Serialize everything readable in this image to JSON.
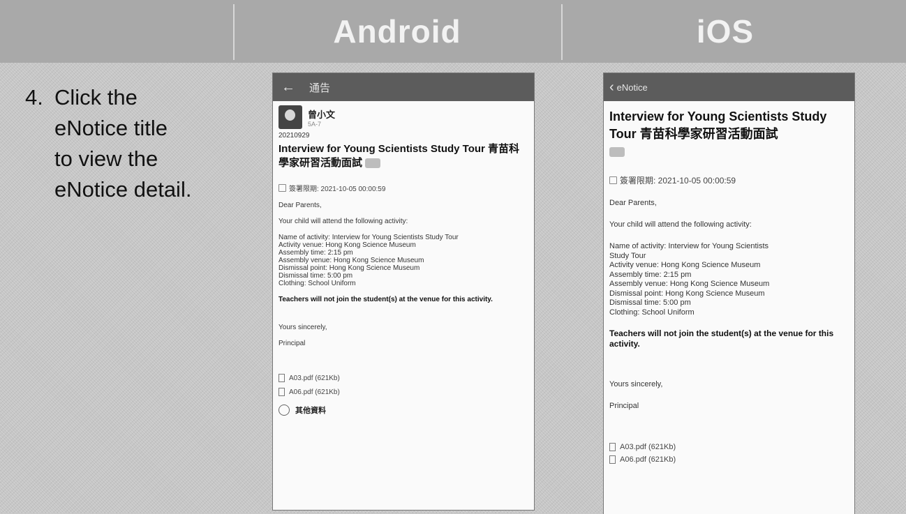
{
  "header": {
    "android_label": "Android",
    "ios_label": "iOS"
  },
  "instruction": {
    "number": "4.",
    "lines": [
      "Click the",
      "eNotice title",
      "to view the",
      "eNotice detail."
    ]
  },
  "android": {
    "appbar_title": "通告",
    "author_name": "曾小文",
    "author_class": "5A-7",
    "date": "20210929",
    "title": "Interview for Young Scientists Study Tour 青苗科學家研習活動面試",
    "deadline": "簽署限期: 2021-10-05 00:00:59",
    "greeting": "Dear Parents,",
    "intro": "Your child will attend the following activity:",
    "details": [
      "Name of activity: Interview for Young Scientists Study Tour",
      "Activity venue: Hong Kong Science Museum",
      "Assembly time: 2:15 pm",
      "Assembly venue: Hong Kong Science Museum",
      "Dismissal point: Hong Kong Science Museum",
      "Dismissal time: 5:00 pm",
      "Clothing: School Uniform"
    ],
    "bold_notice": "Teachers will not join the student(s) at the venue for this activity.",
    "closing": "Yours sincerely,",
    "signature": "Principal",
    "attachments": [
      "A03.pdf (621Kb)",
      "A06.pdf (621Kb)"
    ],
    "more_label": "其他資料"
  },
  "ios": {
    "appbar_title": "eNotice",
    "title": "Interview for Young Scientists Study Tour 青苗科學家研習活動面試",
    "deadline": "簽署限期: 2021-10-05 00:00:59",
    "greeting": "Dear Parents,",
    "intro": "Your child will attend the following activity:",
    "details": [
      "Name of activity: Interview for Young Scientists",
      "Study Tour",
      "Activity venue: Hong Kong Science Museum",
      "Assembly time: 2:15 pm",
      "Assembly venue: Hong Kong Science Museum",
      "Dismissal point: Hong Kong Science Museum",
      "Dismissal time: 5:00 pm",
      "Clothing: School Uniform"
    ],
    "bold_notice": "Teachers will not join the student(s) at the venue for this activity.",
    "closing": "Yours sincerely,",
    "signature": "Principal",
    "attachments": [
      "A03.pdf (621Kb)",
      "A06.pdf (621Kb)"
    ]
  }
}
